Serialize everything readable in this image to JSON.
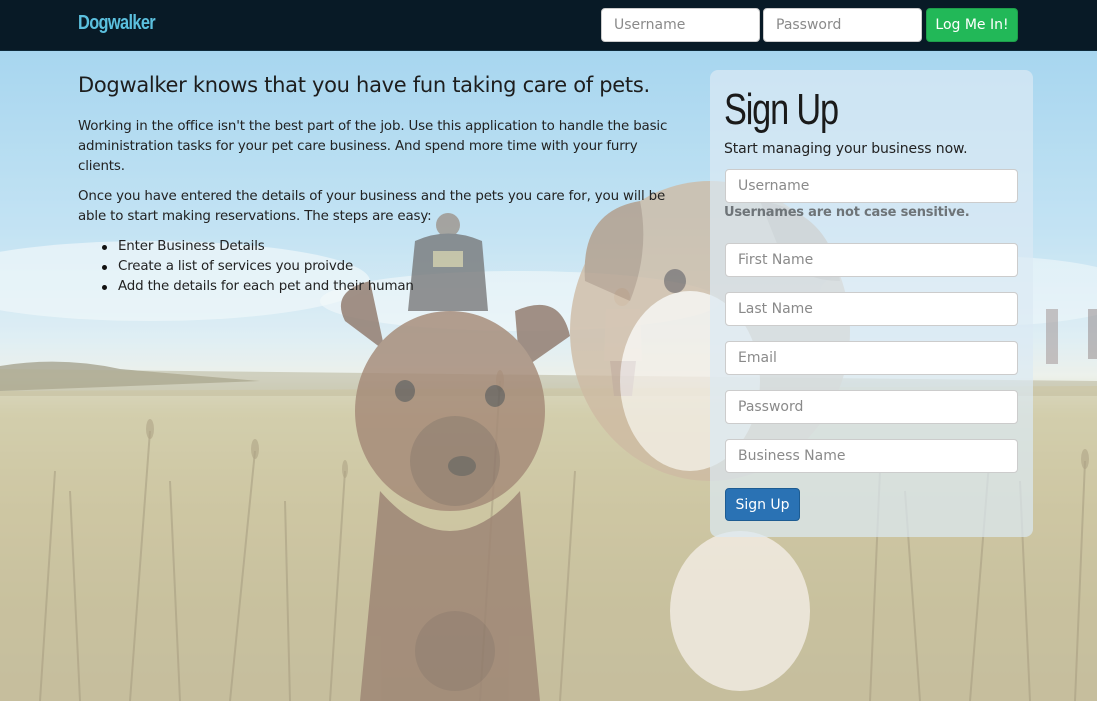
{
  "navbar": {
    "brand": "Dogwalker",
    "username_placeholder": "Username",
    "password_placeholder": "Password",
    "login_label": "Log Me In!"
  },
  "intro": {
    "heading": "Dogwalker knows that you have fun taking care of pets.",
    "paragraph1": "Working in the office isn't the best part of the job. Use this application to handle the basic administration tasks for your pet care business. And spend more time with your furry clients.",
    "paragraph2": "Once you have entered the details of your business and the pets you care for, you will be able to start making reservations. The steps are easy:",
    "steps": [
      "Enter Business Details",
      "Create a list of services you proivde",
      "Add the details for each pet and their human"
    ]
  },
  "signup": {
    "title": "Sign Up",
    "subtitle": "Start managing your business now.",
    "username_placeholder": "Username",
    "username_hint": "Usernames are not case sensitive.",
    "first_name_placeholder": "First Name",
    "last_name_placeholder": "Last Name",
    "email_placeholder": "Email",
    "password_placeholder": "Password",
    "business_name_placeholder": "Business Name",
    "submit_label": "Sign Up"
  },
  "colors": {
    "navbar_bg": "#081a26",
    "brand": "#5bc0de",
    "login_button": "#22b858",
    "signup_button": "#2a72b4",
    "panel_bg": "#dceaf4"
  }
}
